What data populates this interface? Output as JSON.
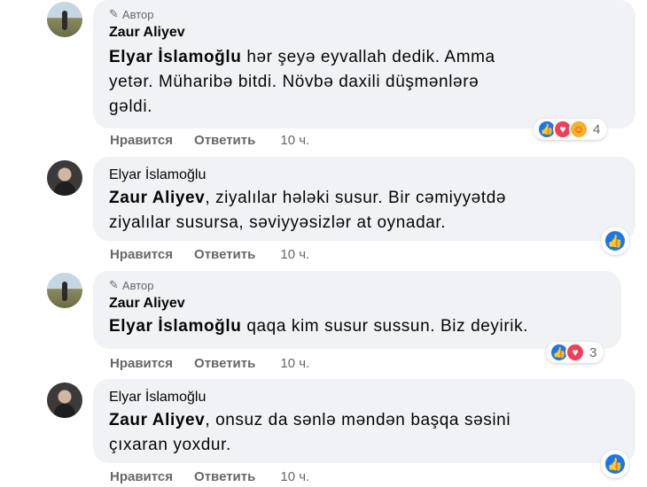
{
  "comments": [
    {
      "badge": "Автор",
      "author": "Zaur Aliyev",
      "mention": "Elyar İslamoğlu",
      "text_lines": [
        "hər şeyə eyvallah dedik. Amma",
        "yetər. Müharibə bitdi. Növbə daxili düşmənlərə",
        "gəldi."
      ],
      "like_label": "Нравится",
      "reply_label": "Ответить",
      "time": "10 ч.",
      "reactions": [
        "like-icon",
        "love-icon",
        "care-icon"
      ],
      "reaction_count": "4"
    },
    {
      "author": "Elyar İslamoğlu",
      "mention": "Zaur Aliyev",
      "text_lines": [
        ", ziyalılar hələki susur. Bir cəmiyyətdə",
        "ziyalılar susursa, səviyyəsizlər at oynadar."
      ],
      "like_label": "Нравится",
      "reply_label": "Ответить",
      "time": "10 ч.",
      "reactions": [
        "like-icon"
      ]
    },
    {
      "badge": "Автор",
      "author": "Zaur Aliyev",
      "mention": "Elyar İslamoğlu",
      "text_lines": [
        " qaqa kim susur sussun. Biz deyirik."
      ],
      "like_label": "Нравится",
      "reply_label": "Ответить",
      "time": "10 ч.",
      "reactions": [
        "like-icon",
        "love-icon"
      ],
      "reaction_count": "3"
    },
    {
      "author": "Elyar İslamoğlu",
      "mention": "Zaur Aliyev",
      "text_lines": [
        ", onsuz da sənlə məndən başqa səsini",
        "çıxaran yoxdur."
      ],
      "like_label": "Нравится",
      "reply_label": "Ответить",
      "time": "10 ч.",
      "reactions": [
        "like-icon"
      ]
    }
  ],
  "icons": {
    "pen": "pen-icon",
    "like": "like-icon",
    "love": "love-icon",
    "care": "care-icon"
  },
  "colors": {
    "like": "#1877f2",
    "love": "#f33e58",
    "care": "#f7b125",
    "bubble": "#f0f2f5",
    "meta": "#65676b"
  }
}
